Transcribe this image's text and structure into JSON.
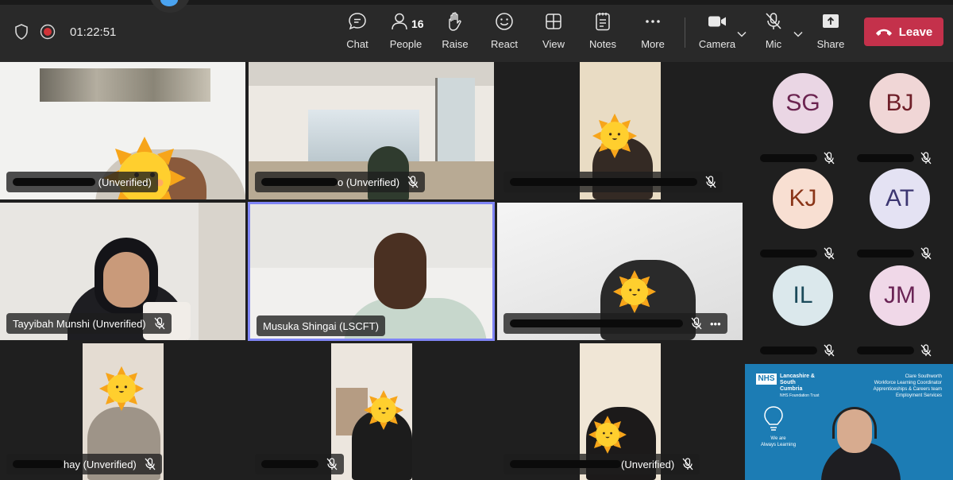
{
  "window": {
    "timer": "01:22:51"
  },
  "toolbar": {
    "chat": "Chat",
    "people": "People",
    "people_count": "16",
    "raise": "Raise",
    "react": "React",
    "view": "View",
    "notes": "Notes",
    "more": "More",
    "camera": "Camera",
    "mic": "Mic",
    "share": "Share",
    "leave": "Leave"
  },
  "tiles": [
    {
      "suffix": " (Unverified)",
      "muted": false
    },
    {
      "suffix": "o (Unverified)",
      "muted": true
    },
    {
      "suffix": "",
      "muted": true
    },
    {
      "name": "Tayyibah Munshi (Unverified)",
      "muted": true
    },
    {
      "name": "Musuka Shingai (LSCFT)",
      "muted": false,
      "active": true
    },
    {
      "suffix": "",
      "muted": true,
      "more": "•••"
    },
    {
      "suffix": "hay (Unverified)",
      "muted": true
    },
    {
      "suffix": "",
      "muted": true
    },
    {
      "suffix": "(Unverified)",
      "muted": true
    }
  ],
  "side_participants": [
    {
      "initials": "SG",
      "bg": "#ead6e4",
      "fg": "#6b2450"
    },
    {
      "initials": "BJ",
      "bg": "#f0d6d6",
      "fg": "#6e1e28"
    },
    {
      "initials": "KJ",
      "bg": "#f8dfd2",
      "fg": "#8a3518"
    },
    {
      "initials": "AT",
      "bg": "#e4e2f3",
      "fg": "#3c3671"
    },
    {
      "initials": "IL",
      "bg": "#dbe8ec",
      "fg": "#1b4a5a"
    },
    {
      "initials": "JM",
      "bg": "#f0d8e8",
      "fg": "#6a2455"
    }
  ],
  "shared_screen": {
    "org": "NHS",
    "org_lines": [
      "Lancashire &",
      "South",
      "Cumbria"
    ],
    "org_sub": "NHS Foundation Trust",
    "slogan": [
      "We are",
      "Always Learning"
    ],
    "presenter_lines": [
      "Clare Southworth",
      "Workforce Learning Coordinator",
      "Apprenticeships & Careers team",
      "Employment Services"
    ]
  }
}
